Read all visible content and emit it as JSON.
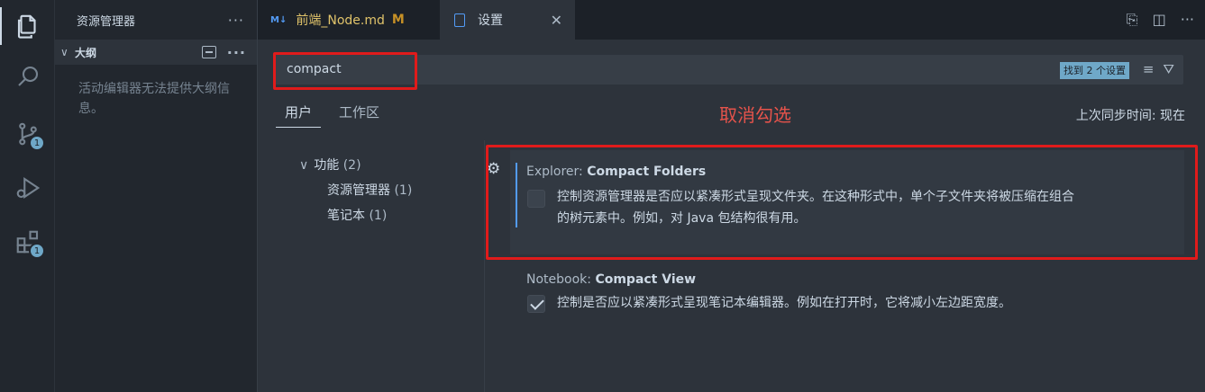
{
  "activity_bar": {
    "items": [
      {
        "icon": "explorer-icon",
        "active": true
      },
      {
        "icon": "search-icon"
      },
      {
        "icon": "source-control-icon",
        "badge": "1"
      },
      {
        "icon": "run-debug-icon"
      },
      {
        "icon": "extensions-icon",
        "badge": "1"
      }
    ]
  },
  "sidebar": {
    "title": "资源管理器",
    "more": "···",
    "outline": {
      "label": "大纲",
      "more": "···",
      "message": "活动编辑器无法提供大纲信息。"
    }
  },
  "tabs": [
    {
      "icon": "M↓",
      "label": "前端_Node.md",
      "modified": "M"
    },
    {
      "label": "设置",
      "close": "✕"
    }
  ],
  "settings": {
    "search_value": "compact",
    "found_badge": "找到 2 个设置",
    "scope_tabs": [
      "用户",
      "工作区"
    ],
    "annotation": "取消勾选",
    "sync_status": "上次同步时间: 现在",
    "toc": {
      "group": "功能",
      "group_count": "(2)",
      "items": [
        {
          "label": "资源管理器",
          "count": "(1)"
        },
        {
          "label": "笔记本",
          "count": "(1)"
        }
      ]
    },
    "items": [
      {
        "category": "Explorer: ",
        "name": "Compact Folders",
        "desc_line1": "控制资源管理器是否应以紧凑形式呈现文件夹。在这种形式中，单个子文件夹将被压缩在组合",
        "desc_line2": "的树元素中。例如，对 Java 包结构很有用。",
        "checked": false
      },
      {
        "category": "Notebook: ",
        "name": "Compact View",
        "desc_line1": "控制是否应以紧凑形式呈现笔记本编辑器。例如在打开时，它将减小左边距宽度。",
        "checked": true
      }
    ]
  },
  "colors": {
    "annotation_red": "#e01b1b",
    "accent": "#539bf5",
    "badge": "#6fa8c8"
  }
}
